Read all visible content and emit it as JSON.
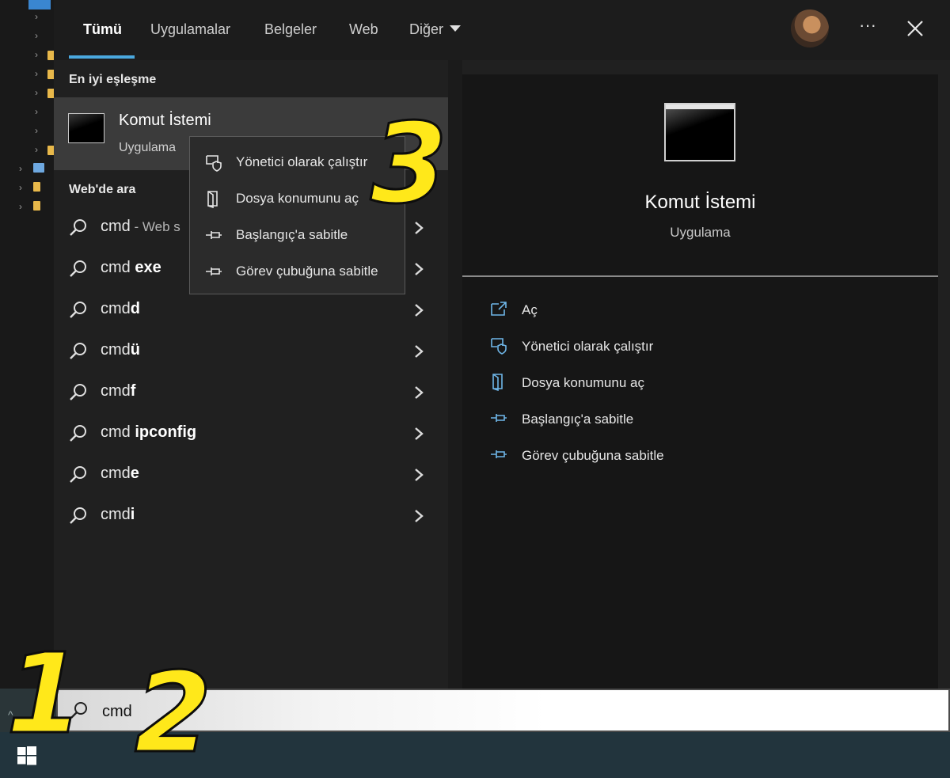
{
  "tabs": [
    {
      "label": "Tümü",
      "active": true
    },
    {
      "label": "Uygulamalar",
      "active": false
    },
    {
      "label": "Belgeler",
      "active": false
    },
    {
      "label": "Web",
      "active": false
    },
    {
      "label": "Diğer",
      "active": false
    }
  ],
  "header": {
    "more_label": "···"
  },
  "best_match": {
    "section_title": "En iyi eşleşme",
    "title": "Komut İstemi",
    "subtitle": "Uygulama"
  },
  "web_search": {
    "section_title": "Web'de ara",
    "results": [
      {
        "prefix": "cmd",
        "bold": "",
        "suffix": " - Web s"
      },
      {
        "prefix": "cmd ",
        "bold": "exe",
        "suffix": ""
      },
      {
        "prefix": "cmd",
        "bold": "d",
        "suffix": ""
      },
      {
        "prefix": "cmd",
        "bold": "ü",
        "suffix": ""
      },
      {
        "prefix": "cmd",
        "bold": "f",
        "suffix": ""
      },
      {
        "prefix": "cmd ",
        "bold": "ipconfig",
        "suffix": ""
      },
      {
        "prefix": "cmd",
        "bold": "e",
        "suffix": ""
      },
      {
        "prefix": "cmd",
        "bold": "i",
        "suffix": ""
      }
    ]
  },
  "context_menu": {
    "items": [
      {
        "label": "Yönetici olarak çalıştır",
        "icon": "shield-icon"
      },
      {
        "label": "Dosya konumunu aç",
        "icon": "file-location-icon"
      },
      {
        "label": "Başlangıç'a sabitle",
        "icon": "pin-icon"
      },
      {
        "label": "Görev çubuğuna sabitle",
        "icon": "pin-icon"
      }
    ]
  },
  "detail": {
    "title": "Komut İstemi",
    "subtitle": "Uygulama",
    "actions": [
      {
        "label": "Aç",
        "icon": "open-icon"
      },
      {
        "label": "Yönetici olarak çalıştır",
        "icon": "shield-icon"
      },
      {
        "label": "Dosya konumunu aç",
        "icon": "file-location-icon"
      },
      {
        "label": "Başlangıç'a sabitle",
        "icon": "pin-icon"
      },
      {
        "label": "Görev çubuğuna sabitle",
        "icon": "pin-icon"
      }
    ]
  },
  "search": {
    "value": "cmd"
  },
  "annotations": {
    "step1": "1",
    "step2": "2",
    "step3": "3"
  },
  "colors": {
    "accent": "#4aa8de",
    "annotation": "#ffe81a",
    "icon_blue": "#6fb6e8"
  }
}
